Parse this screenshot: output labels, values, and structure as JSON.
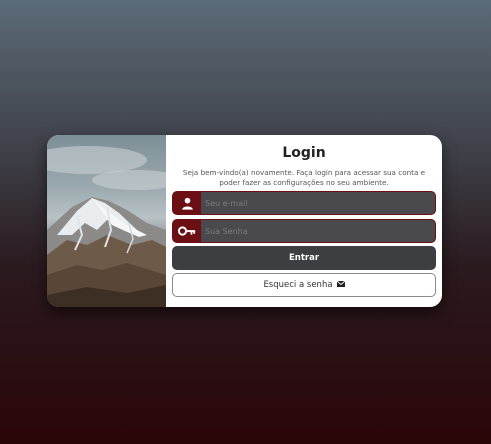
{
  "login": {
    "title": "Login",
    "subtitle": "Seja bem-vindo(a) novamente. Faça login para acessar sua conta e poder fazer as configurações no seu ambiente.",
    "email": {
      "placeholder": "Seu e-mail",
      "value": "",
      "icon": "user-icon"
    },
    "password": {
      "placeholder": "Sua Senha",
      "value": "",
      "icon": "key-icon"
    },
    "submit_label": "Entrar",
    "forgot_label": "Esqueci a senha",
    "forgot_icon": "envelope-icon"
  },
  "colors": {
    "accent": "#6b0f14",
    "field_bg": "#4a4a4e",
    "button_bg": "#3d3e42"
  }
}
